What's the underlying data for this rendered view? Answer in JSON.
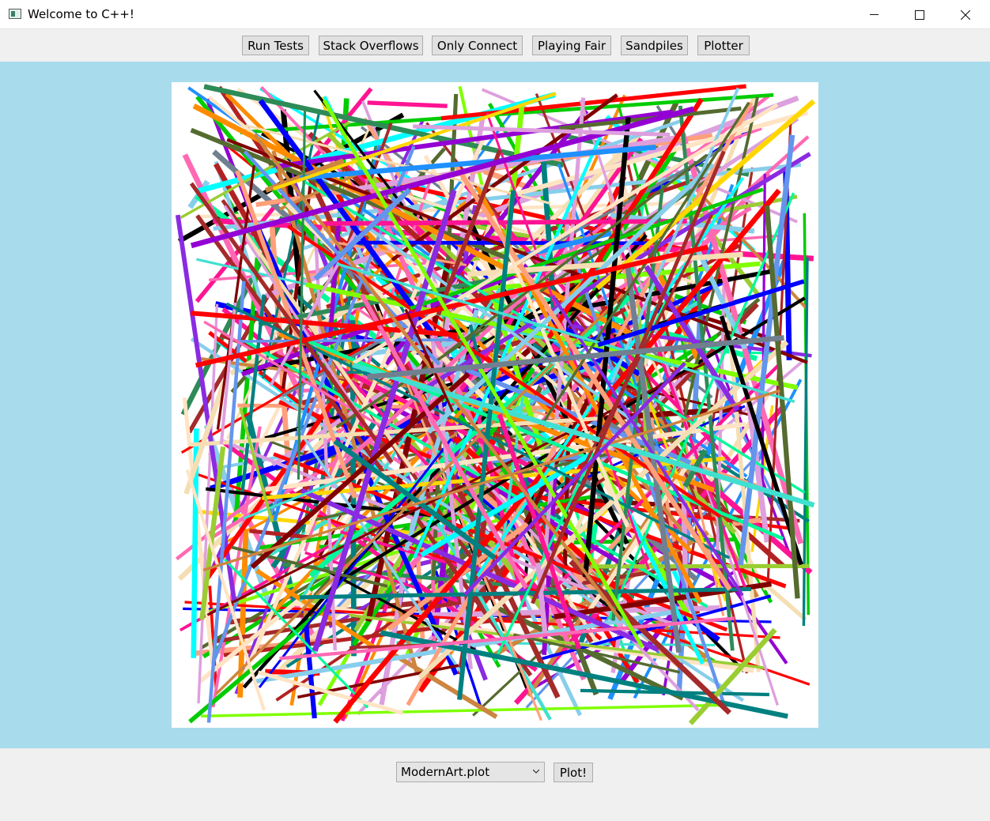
{
  "window": {
    "title": "Welcome to C++!",
    "minimize_icon": "minimize-icon",
    "maximize_icon": "maximize-icon",
    "close_icon": "close-icon"
  },
  "toolbar": {
    "buttons": [
      {
        "label": "Run Tests"
      },
      {
        "label": "Stack Overflows"
      },
      {
        "label": "Only Connect"
      },
      {
        "label": "Playing Fair"
      },
      {
        "label": "Sandpiles"
      },
      {
        "label": "Plotter"
      }
    ]
  },
  "canvas": {
    "background": "#a8dcec",
    "palette": [
      "#ff0000",
      "#00cc00",
      "#0000ff",
      "#ffd700",
      "#ff69b4",
      "#8a2be2",
      "#00ffff",
      "#ff8c00",
      "#008080",
      "#a52a2a",
      "#7fff00",
      "#ff1493",
      "#708090",
      "#000000",
      "#dda0dd",
      "#40e0d0",
      "#b22222",
      "#9acd32",
      "#1e90ff",
      "#f5deb3",
      "#800000",
      "#6495ed",
      "#ffa07a",
      "#2e8b57",
      "#ffe4c4",
      "#9400d3",
      "#00fa9a",
      "#cd853f",
      "#87ceeb",
      "#556b2f"
    ]
  },
  "controls": {
    "file_select_value": "ModernArt.plot",
    "plot_button_label": "Plot!"
  }
}
